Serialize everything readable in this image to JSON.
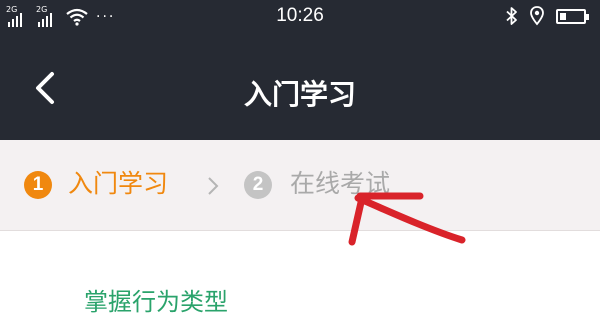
{
  "status_bar": {
    "network_left": "2G",
    "network_right": "2G",
    "more": "···",
    "time": "10:26"
  },
  "nav": {
    "title": "入门学习"
  },
  "steps": [
    {
      "number": "1",
      "label": "入门学习"
    },
    {
      "number": "2",
      "label": "在线考试"
    }
  ],
  "content": {
    "peek_text": "掌握行为类型"
  },
  "colors": {
    "header_bg": "#262a33",
    "step_active": "#f0880f",
    "step_inactive": "#c4c4c4",
    "steps_bg": "#f4f1f2",
    "annotation": "#d9232a",
    "content_text": "#2aa36b"
  }
}
